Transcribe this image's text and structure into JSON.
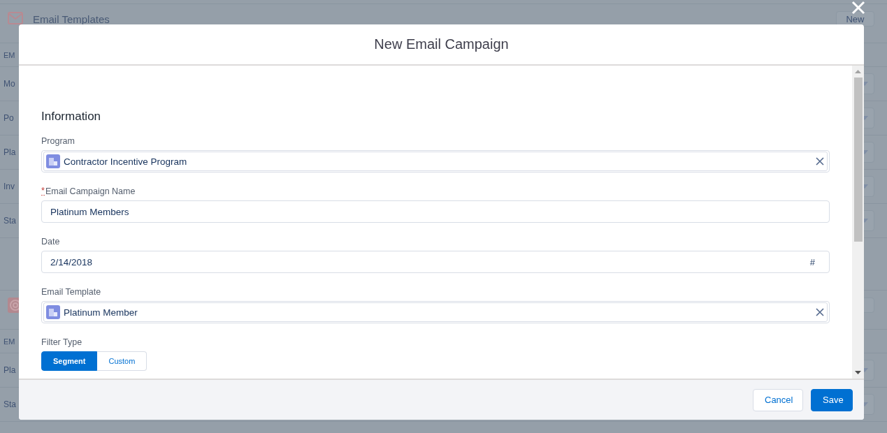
{
  "background": {
    "cards": [
      {
        "kind": "envelope",
        "title": "Email Templates",
        "button": "New",
        "rows": [
          {
            "kind": "header",
            "text": "EM"
          },
          {
            "kind": "item",
            "text": "Mo"
          },
          {
            "kind": "item",
            "text": "Po"
          },
          {
            "kind": "item",
            "text": "Pla"
          },
          {
            "kind": "item",
            "text": "Inv"
          },
          {
            "kind": "item",
            "text": "Sta"
          }
        ]
      },
      {
        "kind": "target",
        "rows": [
          {
            "kind": "header",
            "text": "EM"
          },
          {
            "kind": "item",
            "text": "Pla"
          },
          {
            "kind": "item",
            "text": "Sta"
          }
        ]
      }
    ]
  },
  "modal": {
    "title": "New Email Campaign",
    "section": "Information",
    "fields": [
      {
        "kind": "lookup",
        "label": "Program",
        "value": "Contractor Incentive Program"
      },
      {
        "kind": "text",
        "label": "Email Campaign Name",
        "required_mark": "*",
        "value": "Platinum Members"
      },
      {
        "kind": "date",
        "label": "Date",
        "value": "2/14/2018",
        "icon": "#"
      },
      {
        "kind": "lookup",
        "label": "Email Template",
        "value": "Platinum Member"
      },
      {
        "kind": "segmented",
        "label": "Filter Type",
        "options": [
          {
            "label": "Segment",
            "selected": true
          },
          {
            "label": "Custom",
            "selected": false
          }
        ]
      }
    ],
    "buttons": [
      {
        "kind": "neutral",
        "label": "Cancel"
      },
      {
        "kind": "brand",
        "label": "Save"
      }
    ]
  }
}
